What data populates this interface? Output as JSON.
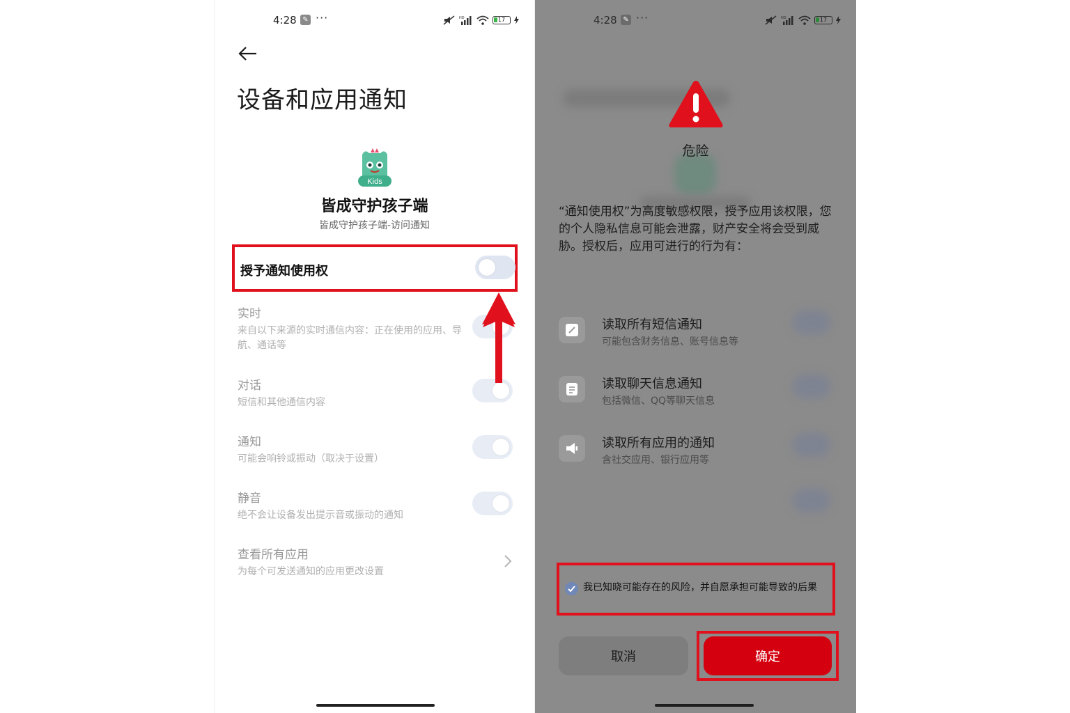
{
  "colors": {
    "highlight_red": "#e0101c",
    "confirm_red": "#d4000f",
    "dim_overlay": "#8b8b8b",
    "toggle_track": "#dfe6f2"
  },
  "left": {
    "status": {
      "time": "4:28",
      "battery": "17"
    },
    "page_title": "设备和应用通知",
    "app": {
      "name": "皆成守护孩子端",
      "subtitle": "皆成守护孩子端-访问通知",
      "badge": "Kids"
    },
    "grant": {
      "label": "授予通知使用权",
      "enabled": false
    },
    "settings": [
      {
        "title": "实时",
        "desc": "来自以下来源的实时通信内容：正在使用的应用、导航、通话等",
        "enabled": true
      },
      {
        "title": "对话",
        "desc": "短信和其他通信内容",
        "enabled": true
      },
      {
        "title": "通知",
        "desc": "可能会响铃或振动（取决于设置）",
        "enabled": true
      },
      {
        "title": "静音",
        "desc": "绝不会让设备发出提示音或振动的通知",
        "enabled": true
      }
    ],
    "view_all": {
      "title": "查看所有应用",
      "desc": "为每个可发送通知的应用更改设置"
    }
  },
  "right": {
    "status": {
      "time": "4:28",
      "battery": "17"
    },
    "danger_title": "危险",
    "danger_body": "“通知使用权”为高度敏感权限，授予应用该权限，您的个人隐私信息可能会泄露，财产安全将会受到威胁。授权后，应用可进行的行为有：",
    "permissions": [
      {
        "title": "读取所有短信通知",
        "desc": "可能包含财务信息、账号信息等",
        "icon": "sms-icon"
      },
      {
        "title": "读取聊天信息通知",
        "desc": "包括微信、QQ等聊天信息",
        "icon": "chat-icon"
      },
      {
        "title": "读取所有应用的通知",
        "desc": "含社交应用、银行应用等",
        "icon": "megaphone-icon"
      }
    ],
    "acknowledge": {
      "text": "我已知晓可能存在的风险，并自愿承担可能导致的后果",
      "checked": true
    },
    "cancel_label": "取消",
    "confirm_label": "确定"
  }
}
